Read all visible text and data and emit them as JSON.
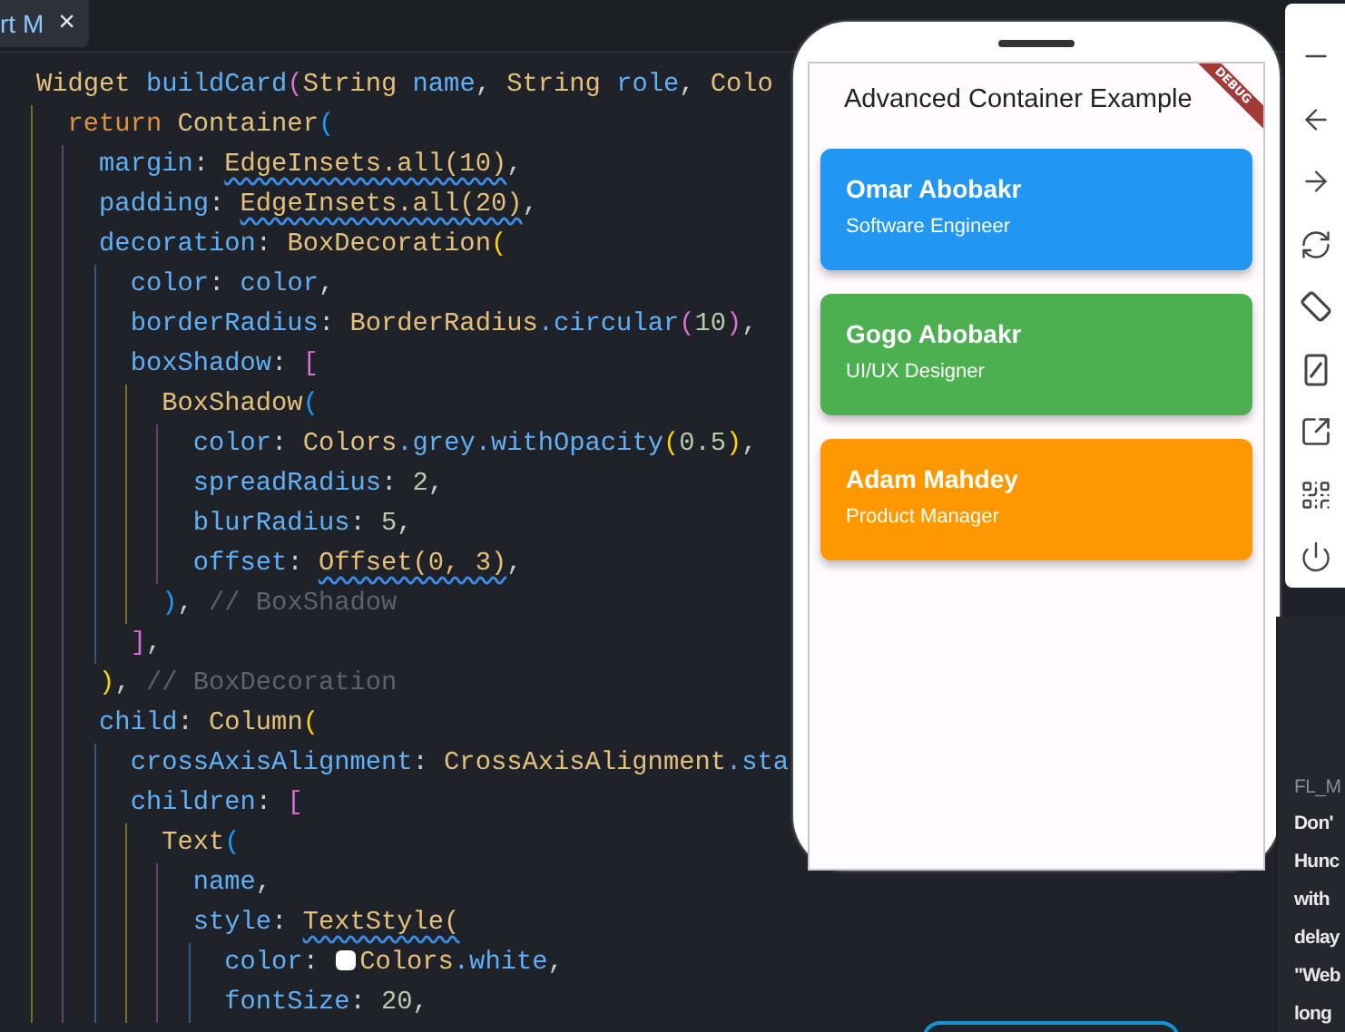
{
  "tab": {
    "label": "rt M",
    "close": "×"
  },
  "code_lines": [
    {
      "tokens": [
        {
          "text": "Widget ",
          "kind": "type"
        },
        {
          "text": "buildCard",
          "kind": "ident"
        },
        {
          "text": "(",
          "kind": "b2"
        },
        {
          "text": "String ",
          "kind": "type"
        },
        {
          "text": "name",
          "kind": "ident"
        },
        {
          "text": ", ",
          "kind": "punct"
        },
        {
          "text": "String ",
          "kind": "type"
        },
        {
          "text": "role",
          "kind": "ident"
        },
        {
          "text": ", ",
          "kind": "punct"
        },
        {
          "text": "Colo",
          "kind": "type"
        }
      ]
    },
    {
      "tokens": [
        {
          "text": "  return ",
          "kind": "kw"
        },
        {
          "text": "Container",
          "kind": "type"
        },
        {
          "text": "(",
          "kind": "b3"
        }
      ]
    },
    {
      "tokens": [
        {
          "text": "    margin",
          "kind": "ident"
        },
        {
          "text": ": ",
          "kind": "punct"
        },
        {
          "text": "EdgeInsets.all(10)",
          "kind": "type",
          "squiggle": true
        },
        {
          "text": ",",
          "kind": "punct"
        }
      ]
    },
    {
      "tokens": [
        {
          "text": "    padding",
          "kind": "ident"
        },
        {
          "text": ": ",
          "kind": "punct"
        },
        {
          "text": "EdgeInsets.all(20)",
          "kind": "type",
          "squiggle": true
        },
        {
          "text": ",",
          "kind": "punct"
        }
      ]
    },
    {
      "tokens": [
        {
          "text": "    decoration",
          "kind": "ident"
        },
        {
          "text": ": ",
          "kind": "punct"
        },
        {
          "text": "BoxDecoration",
          "kind": "type"
        },
        {
          "text": "(",
          "kind": "b1"
        }
      ]
    },
    {
      "tokens": [
        {
          "text": "      color",
          "kind": "ident"
        },
        {
          "text": ": ",
          "kind": "punct"
        },
        {
          "text": "color",
          "kind": "ident"
        },
        {
          "text": ",",
          "kind": "punct"
        }
      ]
    },
    {
      "tokens": [
        {
          "text": "      borderRadius",
          "kind": "ident"
        },
        {
          "text": ": ",
          "kind": "punct"
        },
        {
          "text": "BorderRadius",
          "kind": "type"
        },
        {
          "text": ".circular",
          "kind": "ident"
        },
        {
          "text": "(",
          "kind": "b2"
        },
        {
          "text": "10",
          "kind": "num"
        },
        {
          "text": ")",
          "kind": "b2"
        },
        {
          "text": ",",
          "kind": "punct"
        }
      ]
    },
    {
      "tokens": [
        {
          "text": "      boxShadow",
          "kind": "ident"
        },
        {
          "text": ": ",
          "kind": "punct"
        },
        {
          "text": "[",
          "kind": "b2"
        }
      ]
    },
    {
      "tokens": [
        {
          "text": "        BoxShadow",
          "kind": "type"
        },
        {
          "text": "(",
          "kind": "b3"
        }
      ]
    },
    {
      "tokens": [
        {
          "text": "          color",
          "kind": "ident"
        },
        {
          "text": ": ",
          "kind": "punct"
        },
        {
          "text": "Colors",
          "kind": "type"
        },
        {
          "text": ".grey.withOpacity",
          "kind": "ident"
        },
        {
          "text": "(",
          "kind": "b1"
        },
        {
          "text": "0.5",
          "kind": "num"
        },
        {
          "text": ")",
          "kind": "b1"
        },
        {
          "text": ",",
          "kind": "punct"
        }
      ]
    },
    {
      "tokens": [
        {
          "text": "          spreadRadius",
          "kind": "ident"
        },
        {
          "text": ": ",
          "kind": "punct"
        },
        {
          "text": "2",
          "kind": "num"
        },
        {
          "text": ",",
          "kind": "punct"
        }
      ]
    },
    {
      "tokens": [
        {
          "text": "          blurRadius",
          "kind": "ident"
        },
        {
          "text": ": ",
          "kind": "punct"
        },
        {
          "text": "5",
          "kind": "num"
        },
        {
          "text": ",",
          "kind": "punct"
        }
      ]
    },
    {
      "tokens": [
        {
          "text": "          offset",
          "kind": "ident"
        },
        {
          "text": ": ",
          "kind": "punct"
        },
        {
          "text": "Offset(0, 3)",
          "kind": "type",
          "squiggle": true
        },
        {
          "text": ",",
          "kind": "punct"
        }
      ]
    },
    {
      "tokens": [
        {
          "text": "        )",
          "kind": "b3"
        },
        {
          "text": ", ",
          "kind": "punct"
        },
        {
          "text": "// BoxShadow",
          "kind": "comment"
        }
      ]
    },
    {
      "tokens": [
        {
          "text": "      ]",
          "kind": "b2"
        },
        {
          "text": ",",
          "kind": "punct"
        }
      ]
    },
    {
      "tokens": [
        {
          "text": "    )",
          "kind": "b1"
        },
        {
          "text": ", ",
          "kind": "punct"
        },
        {
          "text": "// BoxDecoration",
          "kind": "comment"
        }
      ]
    },
    {
      "tokens": [
        {
          "text": "    child",
          "kind": "ident"
        },
        {
          "text": ": ",
          "kind": "punct"
        },
        {
          "text": "Column",
          "kind": "type"
        },
        {
          "text": "(",
          "kind": "b1"
        }
      ]
    },
    {
      "tokens": [
        {
          "text": "      crossAxisAlignment",
          "kind": "ident"
        },
        {
          "text": ": ",
          "kind": "punct"
        },
        {
          "text": "CrossAxisAlignment",
          "kind": "type"
        },
        {
          "text": ".sta",
          "kind": "ident"
        }
      ]
    },
    {
      "tokens": [
        {
          "text": "      children",
          "kind": "ident"
        },
        {
          "text": ": ",
          "kind": "punct"
        },
        {
          "text": "[",
          "kind": "b2"
        }
      ]
    },
    {
      "tokens": [
        {
          "text": "        Text",
          "kind": "type"
        },
        {
          "text": "(",
          "kind": "b3"
        }
      ]
    },
    {
      "tokens": [
        {
          "text": "          name",
          "kind": "ident"
        },
        {
          "text": ",",
          "kind": "punct"
        }
      ]
    },
    {
      "tokens": [
        {
          "text": "          style",
          "kind": "ident"
        },
        {
          "text": ": ",
          "kind": "punct"
        },
        {
          "text": "TextStyle(",
          "kind": "type",
          "squiggle": true
        }
      ]
    },
    {
      "tokens": [
        {
          "text": "            color",
          "kind": "ident"
        },
        {
          "text": ": ",
          "kind": "punct"
        },
        {
          "kind": "swatch",
          "color": "#ffffff"
        },
        {
          "text": "Colors",
          "kind": "type"
        },
        {
          "text": ".white",
          "kind": "ident"
        },
        {
          "text": ",",
          "kind": "punct"
        }
      ]
    },
    {
      "tokens": [
        {
          "text": "            fontSize",
          "kind": "ident"
        },
        {
          "text": ": ",
          "kind": "punct"
        },
        {
          "text": "20",
          "kind": "num"
        },
        {
          "text": ",",
          "kind": "punct"
        }
      ]
    }
  ],
  "emulator": {
    "title": "Advanced Container Example",
    "badge": "DEBUG",
    "cards": [
      {
        "name": "Omar Abobakr",
        "role": "Software Engineer",
        "color": "#2196f3"
      },
      {
        "name": "Gogo Abobakr",
        "role": "UI/UX Designer",
        "color": "#4caf50"
      },
      {
        "name": "Adam Mahdey",
        "role": "Product Manager",
        "color": "#ff9800"
      }
    ]
  },
  "side_panel": {
    "heading": "FL_M",
    "lines": [
      "Don'",
      "Hunc",
      "with",
      "delay",
      "\"Web",
      "long"
    ]
  }
}
